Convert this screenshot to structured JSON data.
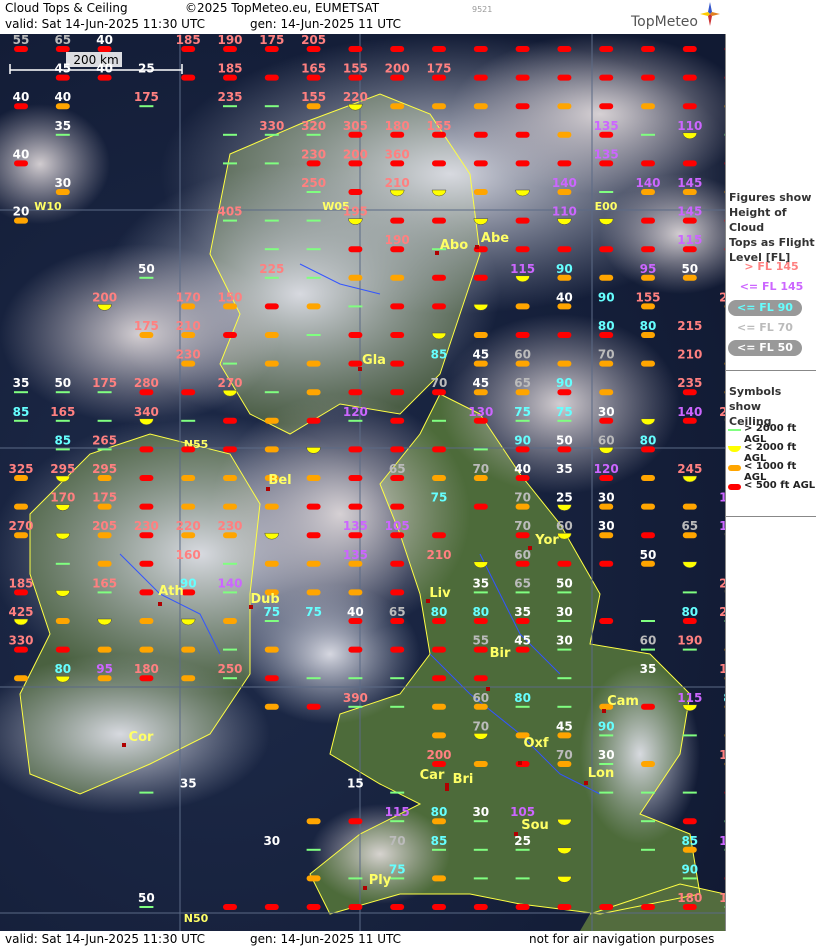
{
  "header": {
    "title": "Cloud Tops & Ceiling",
    "copyright": "©2025 TopMeteo.eu, EUMETSAT",
    "valid": "valid:  Sat  14-Jun-2025  11:30 UTC",
    "gen": "gen: 14-Jun-2025 11 UTC",
    "small_code": "9521",
    "logo": "TopMeteo"
  },
  "footer": {
    "valid": "valid:  Sat  14-Jun-2025  11:30 UTC",
    "gen": "gen: 14-Jun-2025 11 UTC",
    "note": "not for air navigation purposes"
  },
  "scale": "200 km",
  "grid_labels": [
    "W10",
    "W05",
    "E00",
    "N55",
    "N50"
  ],
  "cities": [
    "Abo",
    "Abe",
    "Gla",
    "Bel",
    "Ath",
    "Dub",
    "Liv",
    "Yor",
    "Bir",
    "Cam",
    "Cor",
    "Oxf",
    "Car",
    "Bri",
    "Lon",
    "Sou",
    "Ply"
  ],
  "legend": {
    "tops_title": [
      "Figures show",
      "Height of Cloud",
      "Tops as Flight",
      "Level  [FL]"
    ],
    "tops": [
      {
        "label": "> FL 145",
        "color": "#ff8080"
      },
      {
        "label": "<= FL 145",
        "color": "#cc66ff"
      },
      {
        "label": "<= FL 90",
        "color": "#66ffff"
      },
      {
        "label": "<= FL 70",
        "color": "#bbbbbb"
      },
      {
        "label": "<= FL 50",
        "color": "#ffffff"
      }
    ],
    "ceiling_title": [
      "Symbols show",
      "Ceiling"
    ],
    "ceiling": [
      {
        "label": "> 2000 ft AGL",
        "color": "#80ff80"
      },
      {
        "label": "< 2000 ft AGL",
        "color": "#ffff00"
      },
      {
        "label": "< 1000 ft AGL",
        "color": "#ffa500"
      },
      {
        "label": "< 500 ft AGL",
        "color": "#ff0000"
      }
    ]
  },
  "rows": [
    [
      "55",
      "65",
      "40",
      "",
      "185",
      "190",
      "175",
      "205",
      "",
      "",
      "",
      "",
      "",
      "",
      "",
      "",
      "",
      ""
    ],
    [
      "",
      "45",
      "40",
      "25",
      "",
      "185",
      "",
      "165",
      "155",
      "200",
      "175",
      "",
      "",
      "",
      "",
      "",
      "",
      ""
    ],
    [
      "40",
      "40",
      "",
      "175",
      "",
      "235",
      "",
      "155",
      "220",
      "",
      "",
      "",
      "",
      "",
      "",
      "",
      "",
      ""
    ],
    [
      "",
      "35",
      "",
      "",
      "",
      "",
      "330",
      "320",
      "305",
      "180",
      "155",
      "",
      "",
      "",
      "135",
      "",
      "110",
      ""
    ],
    [
      "40",
      "",
      "",
      "",
      "",
      "",
      "",
      "230",
      "200",
      "360",
      "",
      "",
      "",
      "",
      "135",
      "",
      "",
      ""
    ],
    [
      "",
      "30",
      "",
      "",
      "",
      "",
      "",
      "250",
      "",
      "210",
      "",
      "",
      "",
      "140",
      "",
      "140",
      "145",
      ""
    ],
    [
      "20",
      "",
      "",
      "",
      "",
      "405",
      "",
      "",
      "195",
      "",
      "",
      "",
      "",
      "110",
      "",
      "",
      "145",
      ""
    ],
    [
      "",
      "",
      "",
      "",
      "",
      "",
      "",
      "",
      "",
      "190",
      "",
      "",
      "",
      "",
      "",
      "",
      "115",
      ""
    ],
    [
      "",
      "",
      "",
      "50",
      "",
      "",
      "225",
      "",
      "",
      "",
      "",
      "",
      "115",
      "90",
      "",
      "95",
      "50",
      ""
    ],
    [
      "",
      "",
      "200",
      "",
      "170",
      "150",
      "",
      "",
      "",
      "",
      "",
      "",
      "",
      "40",
      "90",
      "155",
      "",
      "270"
    ],
    [
      "",
      "",
      "",
      "175",
      "210",
      "",
      "",
      "",
      "",
      "",
      "",
      "",
      "",
      "",
      "80",
      "80",
      "215",
      ""
    ],
    [
      "",
      "",
      "",
      "",
      "230",
      "",
      "",
      "",
      "",
      "",
      "85",
      "45",
      "60",
      "",
      "70",
      "",
      "210",
      ""
    ],
    [
      "35",
      "50",
      "175",
      "280",
      "",
      "270",
      "",
      "",
      "",
      "",
      "70",
      "45",
      "65",
      "90",
      "",
      "",
      "235",
      ""
    ],
    [
      "85",
      "165",
      "",
      "340",
      "",
      "",
      "",
      "",
      "120",
      "",
      "",
      "130",
      "75",
      "75",
      "30",
      "",
      "140",
      "260"
    ],
    [
      "",
      "85",
      "265",
      "",
      "",
      "",
      "",
      "",
      "",
      "",
      "",
      "",
      "90",
      "50",
      "60",
      "80",
      "",
      ""
    ],
    [
      "325",
      "295",
      "295",
      "",
      "",
      "",
      "",
      "",
      "",
      "65",
      "",
      "70",
      "40",
      "35",
      "120",
      "",
      "245",
      ""
    ],
    [
      "",
      "170",
      "175",
      "",
      "",
      "",
      "",
      "",
      "",
      "",
      "75",
      "",
      "70",
      "25",
      "30",
      "",
      "",
      "145"
    ],
    [
      "270",
      "",
      "205",
      "230",
      "220",
      "230",
      "",
      "",
      "135",
      "105",
      "",
      "",
      "70",
      "60",
      "30",
      "",
      "65",
      "110"
    ],
    [
      "",
      "",
      "",
      "",
      "160",
      "",
      "",
      "",
      "135",
      "",
      "210",
      "",
      "60",
      "",
      "",
      "50",
      "",
      ""
    ],
    [
      "185",
      "",
      "165",
      "",
      "90",
      "140",
      "",
      "",
      "",
      "",
      "",
      "35",
      "65",
      "50",
      "",
      "",
      "",
      "240"
    ],
    [
      "425",
      "",
      "",
      "",
      "",
      "",
      "75",
      "75",
      "40",
      "65",
      "80",
      "80",
      "35",
      "30",
      "",
      "",
      "80",
      "220"
    ],
    [
      "330",
      "",
      "",
      "",
      "",
      "",
      "",
      "",
      "",
      "",
      "",
      "55",
      "45",
      "30",
      "",
      "60",
      "190",
      ""
    ],
    [
      "",
      "80",
      "95",
      "180",
      "",
      "250",
      "",
      "",
      "",
      "",
      "",
      "",
      "",
      "",
      "",
      "35",
      "",
      "180"
    ],
    [
      "",
      "",
      "",
      "",
      "",
      "",
      "",
      "",
      "390",
      "",
      "",
      "60",
      "80",
      "",
      "",
      "",
      "115",
      "85"
    ],
    [
      "",
      "",
      "",
      "",
      "",
      "",
      "",
      "",
      "",
      "",
      "",
      "70",
      "",
      "45",
      "90",
      "",
      "",
      ""
    ],
    [
      "",
      "",
      "",
      "",
      "",
      "",
      "",
      "",
      "",
      "",
      "200",
      "",
      "",
      "70",
      "30",
      "",
      "",
      "155"
    ],
    [
      "",
      "",
      "",
      "",
      "35",
      "",
      "",
      "",
      "15",
      "",
      "",
      "",
      "",
      "",
      "",
      "",
      "",
      ""
    ],
    [
      "",
      "",
      "",
      "",
      "",
      "",
      "",
      "",
      "",
      "115",
      "80",
      "30",
      "105",
      "",
      "",
      "",
      "",
      ""
    ],
    [
      "",
      "",
      "",
      "",
      "",
      "",
      "30",
      "",
      "",
      "70",
      "85",
      "",
      "25",
      "",
      "",
      "",
      "85",
      "120"
    ],
    [
      "",
      "",
      "",
      "",
      "",
      "",
      "",
      "",
      "",
      "75",
      "",
      "",
      "",
      "",
      "",
      "",
      "90",
      ""
    ],
    [
      "",
      "",
      "",
      "50",
      "",
      "",
      "",
      "",
      "",
      "",
      "",
      "",
      "",
      "",
      "",
      "",
      "180",
      "160"
    ]
  ],
  "symbols": [
    "RRR.RRRRRRRRRRRRRR",
    ".RR.RRRRRRRRRRRRRR",
    "RO.G.GGOYOOORORORO",
    ".G...GGGRRRRRORGYG",
    "R....GGRRRRRRRRRRR",
    ".O.....GRYYOYOGOOO",
    "O....GGGYRRYRYYRRR",
    "......GGRRGRRRRRRR",
    "...G..GGOORRYOOOO.",
    "..Y.OOROGRRYOO.O.O",
    "...OOROGRRYORRRO..",
    "....OGOORR.OOOOO.O",
    "GGGRRYGORRROORO.RO",
    "GGGYGRORGRGRGGRYRY",
    ".GGRRROYRRRGRRYR..",
    "OYOROOOORROOR.ROY.",
    "OYOROOORRR.ROYOOO.",
    "OYOROOYRRRR.RYOROY",
    ".GOR.GOOOR.YRRROY.",
    "RYGRRGOOOR.GGG..GY",
    "YOYOYOG.RRRRRGRGRG",
    "RROOOGO.RRRRRG.GGO",
    "OYOROGRGGGRR.G...O",
    "......ORGGOOGGORYO",
    "..........OYOOG.GO",
    "..........ROROGO.O",
    "...G.....G....GGGR",
    ".......ORGOG.Y.GRG",
    ".......G..GGGY.GOG",
    ".......OGGOGGY..GR",
    "...G.RRRRRRRRRRRRG"
  ]
}
